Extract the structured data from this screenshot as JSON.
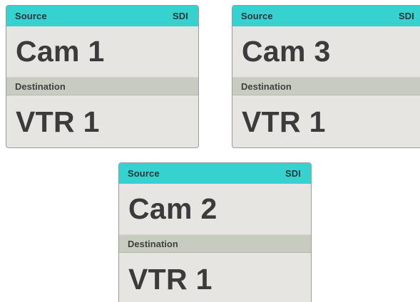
{
  "colors": {
    "header_accent": "#36d2cf",
    "panel_background": "#e7e5e1",
    "destination_bar": "#c8cbc0",
    "text_dark": "#3a3b3a"
  },
  "panels": [
    {
      "source_label": "Source",
      "format": "SDI",
      "source_name": "Cam 1",
      "destination_label": "Destination",
      "destination_name": "VTR 1"
    },
    {
      "source_label": "Source",
      "format": "SDI",
      "source_name": "Cam 3",
      "destination_label": "Destination",
      "destination_name": "VTR 1"
    },
    {
      "source_label": "Source",
      "format": "SDI",
      "source_name": "Cam 2",
      "destination_label": "Destination",
      "destination_name": "VTR 1"
    }
  ]
}
